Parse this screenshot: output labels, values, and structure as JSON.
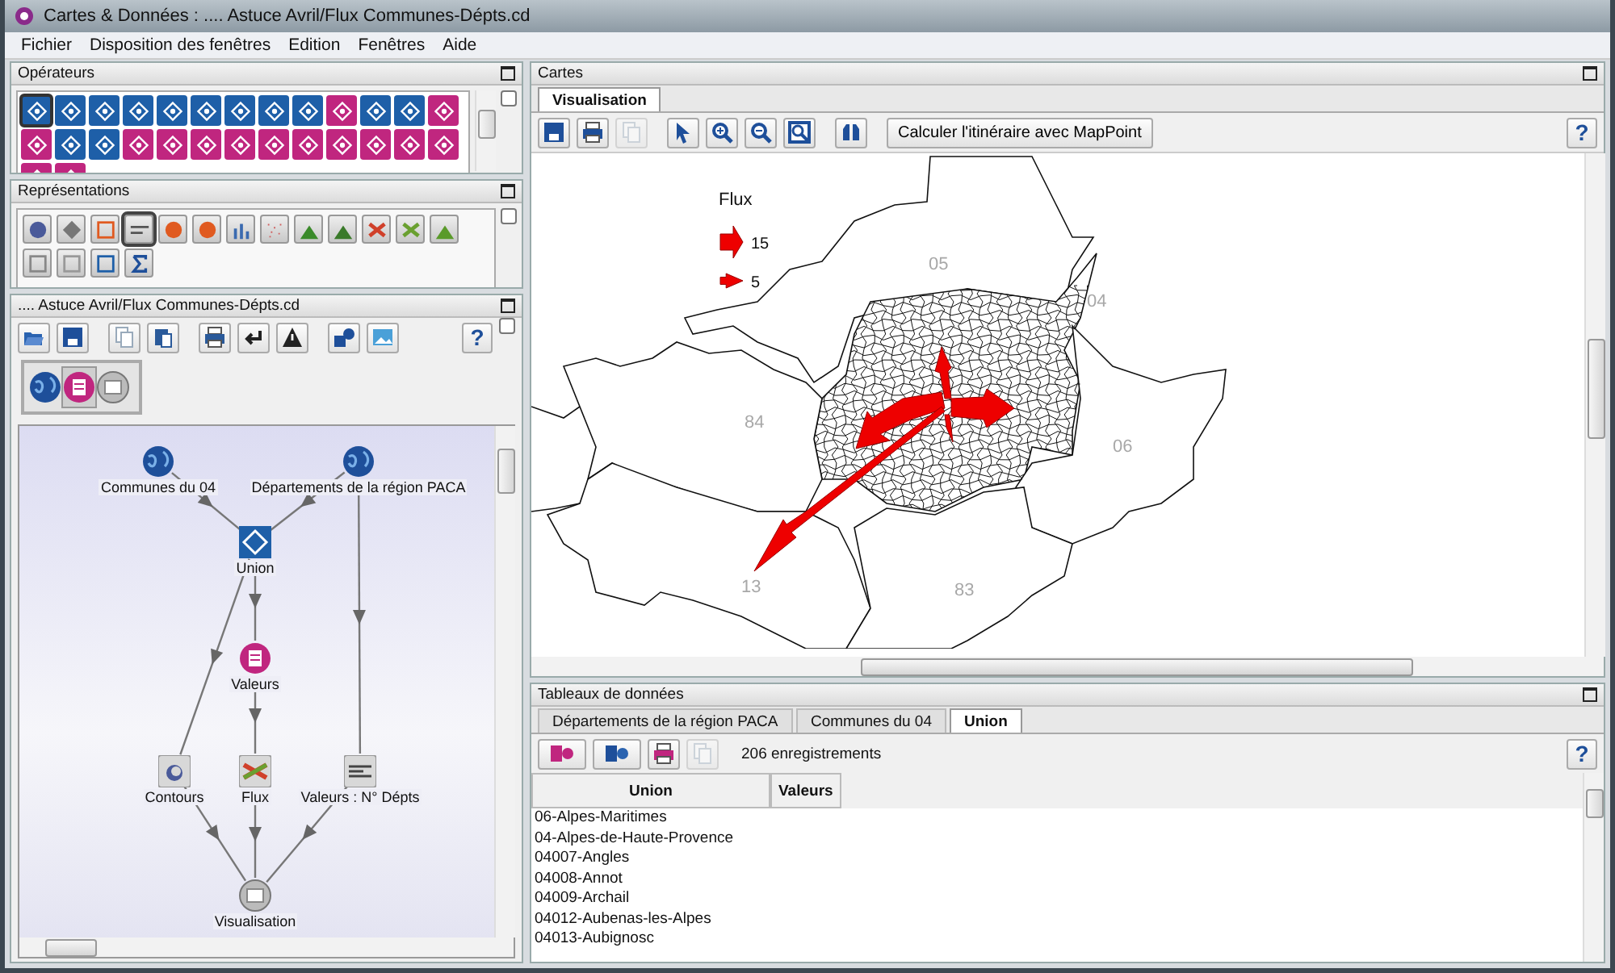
{
  "window": {
    "title": "Cartes & Données : .... Astuce Avril/Flux Communes-Dépts.cd"
  },
  "menu": [
    "Fichier",
    "Disposition des fenêtres",
    "Edition",
    "Fenêtres",
    "Aide"
  ],
  "operators": {
    "title": "Opérateurs",
    "items": [
      {
        "color": "#1e5fa8",
        "selected": true
      },
      {
        "color": "#1e5fa8",
        "selected": false
      },
      {
        "color": "#1e5fa8",
        "selected": false
      },
      {
        "color": "#1e5fa8",
        "selected": false
      },
      {
        "color": "#1e5fa8",
        "selected": false
      },
      {
        "color": "#1e5fa8",
        "selected": false
      },
      {
        "color": "#1e5fa8",
        "selected": false
      },
      {
        "color": "#1e5fa8",
        "selected": false
      },
      {
        "color": "#1e5fa8",
        "selected": false
      },
      {
        "color": "#c0267f",
        "selected": false
      },
      {
        "color": "#1e5fa8",
        "selected": false
      },
      {
        "color": "#1e5fa8",
        "selected": false
      },
      {
        "color": "#c0267f",
        "selected": false
      },
      {
        "color": "#c0267f",
        "selected": false
      },
      {
        "color": "#1e5fa8",
        "selected": false
      },
      {
        "color": "#1e5fa8",
        "selected": false
      },
      {
        "color": "#c0267f",
        "selected": false
      },
      {
        "color": "#c0267f",
        "selected": false
      },
      {
        "color": "#c0267f",
        "selected": false
      },
      {
        "color": "#c0267f",
        "selected": false
      },
      {
        "color": "#c0267f",
        "selected": false
      },
      {
        "color": "#c0267f",
        "selected": false
      },
      {
        "color": "#c0267f",
        "selected": false
      },
      {
        "color": "#c0267f",
        "selected": false
      },
      {
        "color": "#c0267f",
        "selected": false
      },
      {
        "color": "#c0267f",
        "selected": false
      },
      {
        "color": "#c0267f",
        "selected": false
      },
      {
        "color": "#c0267f",
        "selected": false
      }
    ]
  },
  "representations": {
    "title": "Représentations",
    "items": [
      {
        "selected": false
      },
      {
        "selected": false
      },
      {
        "selected": false
      },
      {
        "selected": true
      },
      {
        "selected": false
      },
      {
        "selected": false
      },
      {
        "selected": false
      },
      {
        "selected": false
      },
      {
        "selected": false
      },
      {
        "selected": false
      },
      {
        "selected": false
      },
      {
        "selected": false
      },
      {
        "selected": false
      },
      {
        "selected": false
      },
      {
        "selected": false
      },
      {
        "selected": false
      },
      {
        "selected": false
      }
    ]
  },
  "document": {
    "title": ".... Astuce Avril/Flux Communes-Dépts.cd",
    "help": "?",
    "palette": [
      {
        "kind": "map",
        "selected": false
      },
      {
        "kind": "data",
        "selected": true
      },
      {
        "kind": "view",
        "selected": false
      }
    ],
    "nodes": [
      {
        "label": "Communes du 04",
        "kind": "map"
      },
      {
        "label": "Départements de la région PACA",
        "kind": "map"
      },
      {
        "label": "Union",
        "kind": "operator"
      },
      {
        "label": "Valeurs",
        "kind": "data"
      },
      {
        "label": "Contours",
        "kind": "contour"
      },
      {
        "label": "Flux",
        "kind": "flow"
      },
      {
        "label": "Valeurs : N° Dépts",
        "kind": "labels"
      },
      {
        "label": "Visualisation",
        "kind": "view"
      }
    ]
  },
  "cartes": {
    "title": "Cartes",
    "tabs": [
      {
        "label": "Visualisation",
        "selected": true
      }
    ],
    "toolbar": [
      {
        "disabled": false
      },
      {
        "disabled": false
      },
      {
        "disabled": true
      },
      {
        "disabled": false
      },
      {
        "disabled": false
      },
      {
        "disabled": false
      },
      {
        "disabled": false
      },
      {
        "disabled": false
      }
    ],
    "route_button": "Calculer l'itinéraire avec MapPoint",
    "help": "?",
    "map": {
      "legend_title": "Flux",
      "legend": [
        "15",
        "5"
      ],
      "departments": [
        "05",
        "04",
        "84",
        "06",
        "13",
        "83"
      ]
    }
  },
  "tables": {
    "title": "Tableaux de données",
    "tabs": [
      {
        "label": "Départements de la région PACA",
        "selected": false
      },
      {
        "label": "Communes du 04",
        "selected": false
      },
      {
        "label": "Union",
        "selected": true
      }
    ],
    "toolbar": [
      {
        "disabled": false
      },
      {
        "disabled": false
      },
      {
        "disabled": false
      },
      {
        "disabled": true
      }
    ],
    "record_count": "206 enregistrements",
    "help": "?",
    "columns": [
      "Union",
      "Valeurs"
    ],
    "rows": [
      "06-Alpes-Maritimes",
      "04-Alpes-de-Haute-Provence",
      "04007-Angles",
      "04008-Annot",
      "04009-Archail",
      "04012-Aubenas-les-Alpes",
      "04013-Aubignosc"
    ]
  }
}
